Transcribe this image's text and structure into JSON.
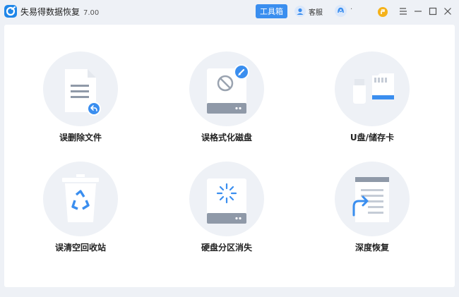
{
  "app": {
    "title": "失易得数据恢复",
    "version": "7.00"
  },
  "header": {
    "toolbox_label": "工具箱",
    "service_label": "客服",
    "user_text": "·"
  },
  "cards": [
    {
      "label": "误删除文件"
    },
    {
      "label": "误格式化磁盘"
    },
    {
      "label": "U盘/储存卡"
    },
    {
      "label": "误清空回收站"
    },
    {
      "label": "硬盘分区消失"
    },
    {
      "label": "深度恢复"
    }
  ],
  "colors": {
    "accent": "#3a8eef",
    "background": "#eef1f6",
    "panel": "#ffffff"
  }
}
